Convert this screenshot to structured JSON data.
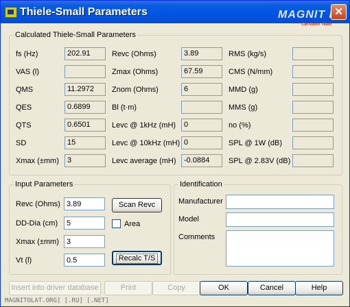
{
  "window": {
    "title": "Thiele-Small Parameters",
    "brand": "MAGNIT LA",
    "brand_sub": "CarAudio Team",
    "close_label": "✕"
  },
  "calculated": {
    "title": "Calculated Thiele-Small Parameters",
    "col1": [
      {
        "label": "fs (Hz)",
        "value": "202.91"
      },
      {
        "label": "VAS (l)",
        "value": ""
      },
      {
        "label": "QMS",
        "value": "11.2972"
      },
      {
        "label": "QES",
        "value": "0.6899"
      },
      {
        "label": "QTS",
        "value": "0.6501"
      },
      {
        "label": "SD",
        "value": "15"
      },
      {
        "label": "Xmax (±mm)",
        "value": "3"
      }
    ],
    "col2": [
      {
        "label": "Revc (Ohms)",
        "value": "3.89"
      },
      {
        "label": "Zmax (Ohms)",
        "value": "67.59"
      },
      {
        "label": "Znom (Ohms)",
        "value": "6"
      },
      {
        "label": "Bl (t·m)",
        "value": ""
      },
      {
        "label": "Levc @ 1kHz (mH)",
        "value": "0"
      },
      {
        "label": "Levc @ 10kHz (mH)",
        "value": "0"
      },
      {
        "label": "Levc average (mH)",
        "value": "-0.0884"
      }
    ],
    "col3": [
      {
        "label": "RMS (kg/s)",
        "value": ""
      },
      {
        "label": "CMS (N/mm)",
        "value": ""
      },
      {
        "label": "MMD (g)",
        "value": ""
      },
      {
        "label": "MMS (g)",
        "value": ""
      },
      {
        "label": "no (%)",
        "value": ""
      },
      {
        "label": "SPL @ 1W (dB)",
        "value": ""
      },
      {
        "label": "SPL @ 2.83V (dB)",
        "value": ""
      }
    ]
  },
  "input": {
    "title": "Input Parameters",
    "revc_label": "Revc (Ohms)",
    "revc_value": "3.89",
    "dd_label": "DD-Dia (cm)",
    "dd_value": "5",
    "xmax_label": "Xmax (±mm)",
    "xmax_value": "3",
    "vt_label": "Vt (l)",
    "vt_value": "0.5",
    "scan_revc": "Scan Revc",
    "area_label": "Area",
    "area_checked": false,
    "recalc": "Recalc T/S"
  },
  "identification": {
    "title": "Identification",
    "manufacturer_label": "Manufacturer",
    "manufacturer_value": "",
    "model_label": "Model",
    "model_value": "",
    "comments_label": "Comments",
    "comments_value": ""
  },
  "buttons": {
    "insert": "Insert into driver database",
    "print": "Print",
    "copy": "Copy",
    "ok": "OK",
    "cancel": "Cancel",
    "help": "Help"
  },
  "watermark": "MAGNITOLAT.ORG] [.RU] [.NET]"
}
